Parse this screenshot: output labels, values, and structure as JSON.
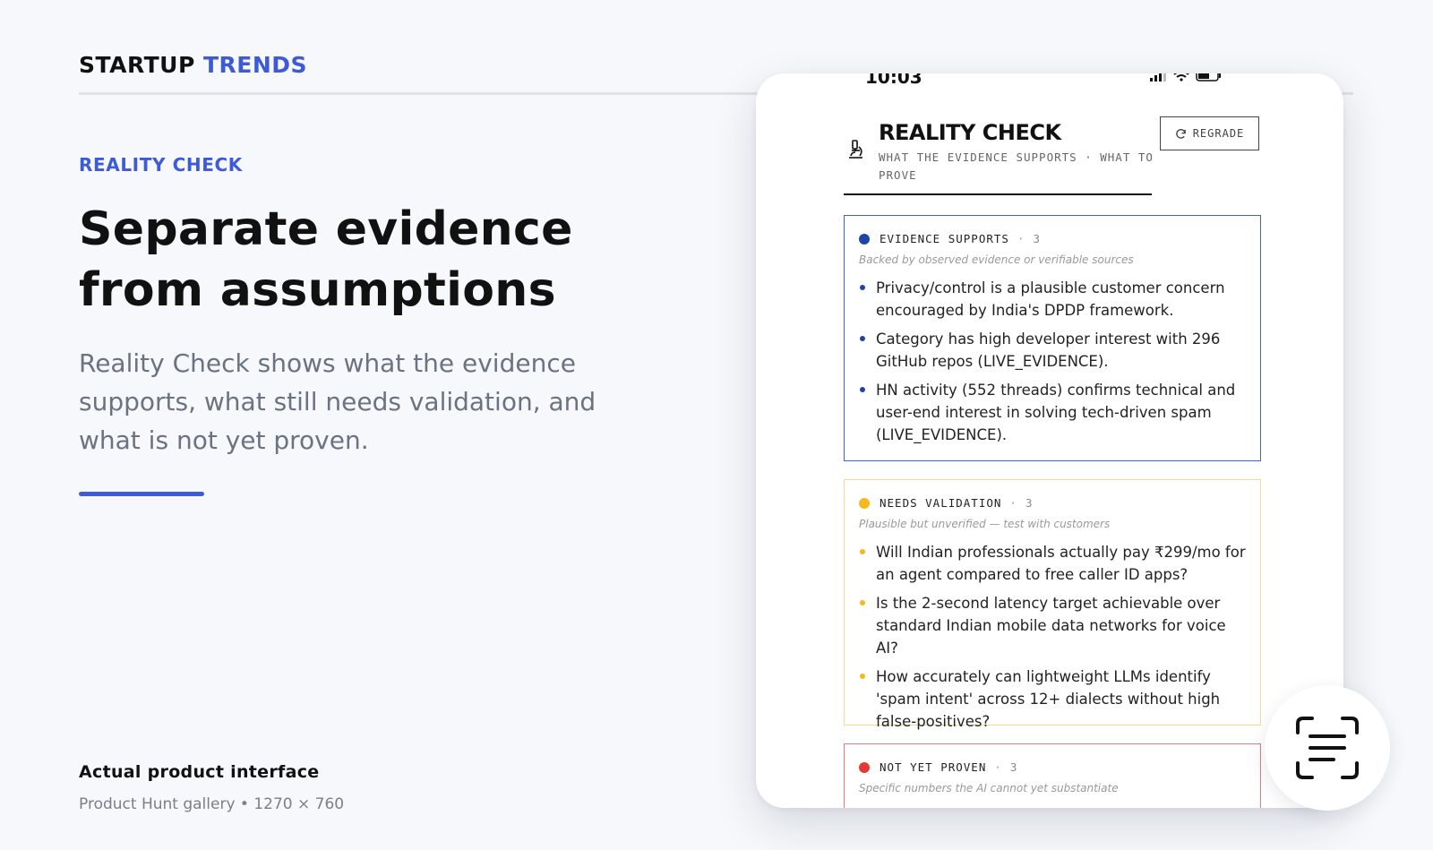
{
  "brand": {
    "part1": "STARTUP",
    "part2": "TRENDS"
  },
  "hero": {
    "eyebrow": "REALITY CHECK",
    "headline": "Separate evidence from assumptions",
    "lede": "Reality Check shows what the evidence supports, what still needs validation, and what is not yet proven."
  },
  "caption": {
    "title": "Actual product interface",
    "sub": "Product Hunt gallery • 1270 × 760"
  },
  "phone": {
    "status": {
      "time": "10:03",
      "icons": "signal-icon wifi-icon battery-icon"
    },
    "header": {
      "title": "REALITY CHECK",
      "subtitle": "WHAT THE EVIDENCE SUPPORTS · WHAT TO PROVE",
      "regrade_label": "REGRADE",
      "icon": "microscope-icon"
    },
    "cards": [
      {
        "key": "supports",
        "label": "EVIDENCE SUPPORTS",
        "count": "3",
        "note": "Backed by observed evidence or verifiable sources",
        "color": "#1f44a8",
        "items": [
          "Privacy/control is a plausible customer concern encouraged by India's DPDP framework.",
          "Category has high developer interest with 296 GitHub repos (LIVE_EVIDENCE).",
          "HN activity (552 threads) confirms technical and user-end interest in solving tech-driven spam (LIVE_EVIDENCE)."
        ]
      },
      {
        "key": "validation",
        "label": "NEEDS VALIDATION",
        "count": "3",
        "note": "Plausible but unverified — test with customers",
        "color": "#f5b91e",
        "items": [
          "Will Indian professionals actually pay ₹299/mo for an agent compared to free caller ID apps?",
          "Is the 2-second latency target achievable over standard Indian mobile data networks for voice AI?",
          "How accurately can lightweight LLMs identify 'spam intent' across 12+ dialects without high false-positives?"
        ]
      },
      {
        "key": "notproven",
        "label": "NOT YET PROVEN",
        "count": "3",
        "note": "Specific numbers the AI cannot yet substantiate",
        "color": "#e53935",
        "items": []
      }
    ]
  },
  "floating": {
    "icon": "text-scan-icon"
  }
}
